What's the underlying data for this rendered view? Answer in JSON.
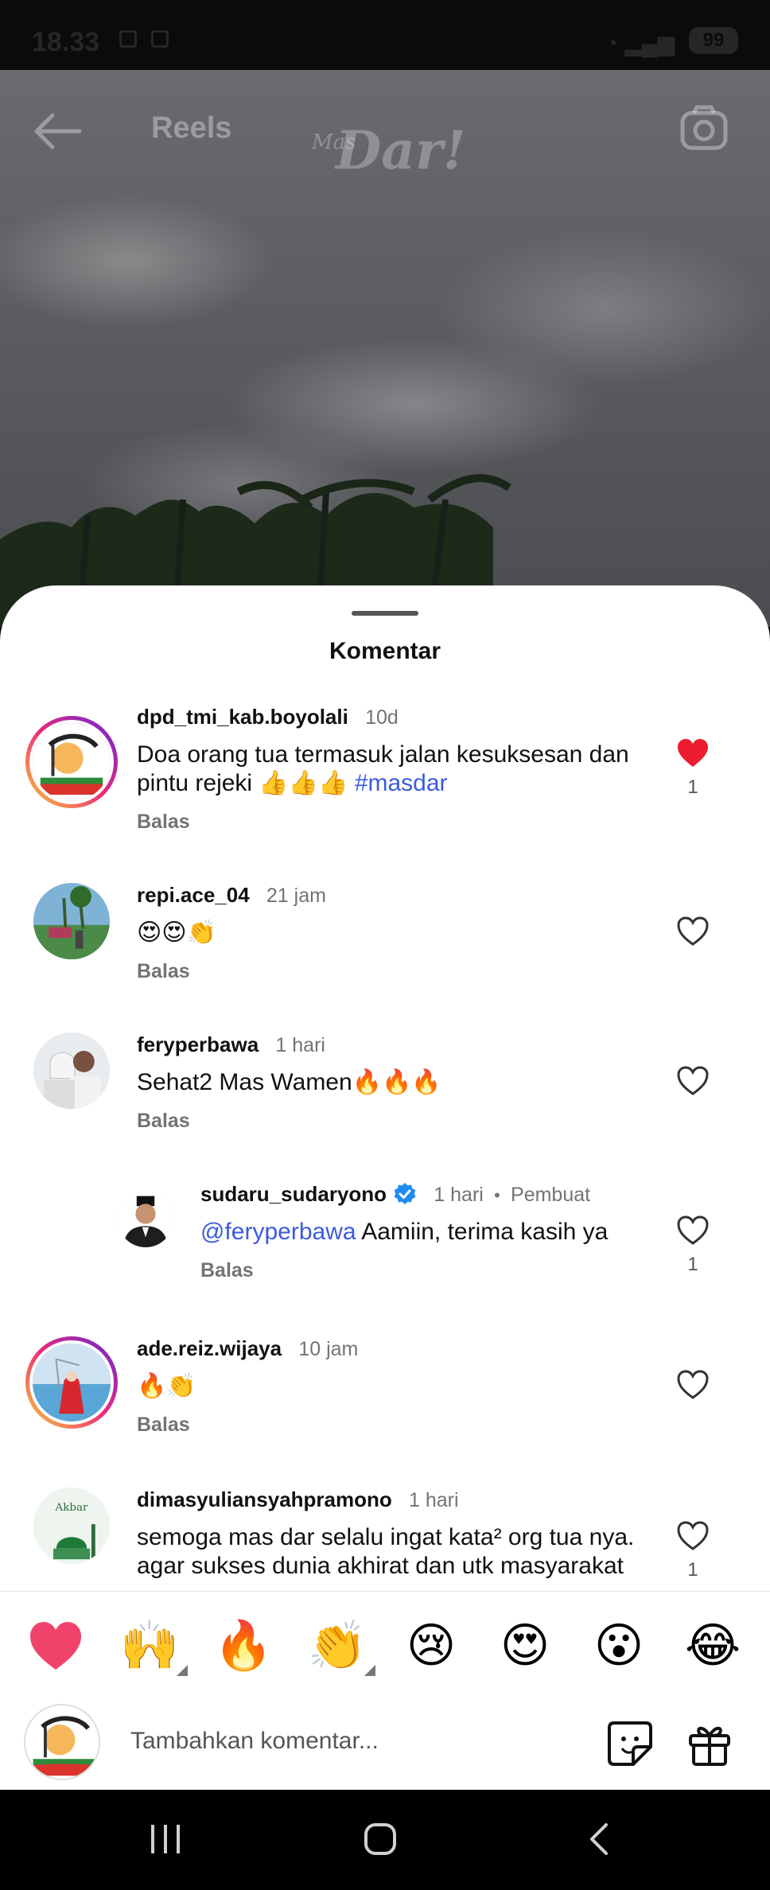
{
  "status_bar": {
    "time": "18.33",
    "battery": "99"
  },
  "top_nav": {
    "title": "Reels",
    "logo_small": "Mas",
    "logo_main": "Dar!"
  },
  "sheet": {
    "title": "Komentar"
  },
  "comments": [
    {
      "username": "dpd_tmi_kab.boyolali",
      "time": "10d",
      "text": "Doa orang tua termasuk jalan kesuksesan dan pintu rejeki 👍👍👍 ",
      "hashtag": "#masdar",
      "reply_label": "Balas",
      "likes": "1",
      "liked": true
    },
    {
      "username": "repi.ace_04",
      "time": "21 jam",
      "text": "😍😍👏",
      "reply_label": "Balas",
      "liked": false
    },
    {
      "username": "feryperbawa",
      "time": "1 hari",
      "text": "Sehat2 Mas Wamen🔥🔥🔥",
      "reply_label": "Balas",
      "liked": false
    },
    {
      "username": "sudaru_sudaryono",
      "time": "1 hari",
      "creator_label": "Pembuat",
      "mention": "@feryperbawa",
      "text": " Aamiin, terima kasih ya",
      "reply_label": "Balas",
      "likes": "1",
      "liked": false
    },
    {
      "username": "ade.reiz.wijaya",
      "time": "10 jam",
      "text": "🔥👏",
      "reply_label": "Balas",
      "liked": false
    },
    {
      "username": "dimasyuliansyahpramono",
      "time": "1 hari",
      "text": "semoga mas dar selalu ingat kata² org tua nya. agar sukses dunia akhirat dan utk masyarakat",
      "likes": "1",
      "liked": false
    }
  ],
  "emoji_bar": [
    "❤️",
    "🙌",
    "🔥",
    "👏",
    "😢",
    "😍",
    "😮",
    "😂"
  ],
  "input": {
    "placeholder": "Tambahkan komentar..."
  },
  "colors": {
    "accent_link": "#3b5bdb",
    "like_red": "#ed1c2e",
    "verified_blue": "#1f8cf0"
  },
  "icons": [
    "back-arrow-icon",
    "camera-icon",
    "heart-icon",
    "verified-badge-icon",
    "sticker-icon",
    "gift-icon",
    "recents-icon",
    "home-icon",
    "nav-back-icon"
  ]
}
